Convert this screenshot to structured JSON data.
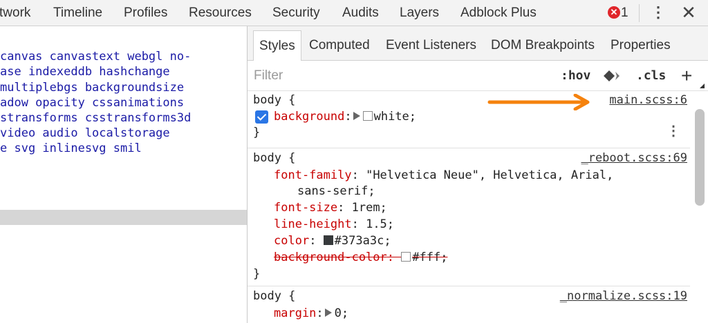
{
  "main_tabs": [
    "twork",
    "Timeline",
    "Profiles",
    "Resources",
    "Security",
    "Audits",
    "Layers",
    "Adblock Plus"
  ],
  "error_count": "1",
  "left_pane": {
    "lines": [
      "canvas canvastext webgl no-",
      "ase indexeddb hashchange",
      "multiplebgs backgroundsize",
      "adow opacity cssanimations",
      "stransforms csstransforms3d",
      "video audio localstorage",
      "e svg inlinesvg smil"
    ]
  },
  "sub_tabs": [
    "Styles",
    "Computed",
    "Event Listeners",
    "DOM Breakpoints",
    "Properties"
  ],
  "filter": {
    "placeholder": "Filter",
    "hov": ":hov",
    "cls": ".cls",
    "add": "+"
  },
  "rules": [
    {
      "selector": "body {",
      "source": "main.scss:6",
      "declarations": [
        {
          "prop": "background",
          "sep": ":",
          "value": "white;",
          "swatch": "#ffffff",
          "expand": true,
          "checked": true
        }
      ],
      "close": "}"
    },
    {
      "selector": "body {",
      "source": "_reboot.scss:69",
      "declarations": [
        {
          "prop": "font-family",
          "sep": ": ",
          "value": "\"Helvetica Neue\", Helvetica, Arial,",
          "continuation": "sans-serif;"
        },
        {
          "prop": "font-size",
          "sep": ": ",
          "value": "1rem;"
        },
        {
          "prop": "line-height",
          "sep": ": ",
          "value": "1.5;"
        },
        {
          "prop": "color",
          "sep": ": ",
          "value": "#373a3c;",
          "swatch": "#373a3c"
        },
        {
          "prop": "background-color",
          "sep": ": ",
          "value": "#fff;",
          "swatch": "#ffffff",
          "overridden": true
        }
      ],
      "close": "}"
    },
    {
      "selector": "body {",
      "source": "_normalize.scss:19",
      "declarations": [
        {
          "prop": "margin",
          "sep": ":",
          "value": "0;",
          "expand": true
        }
      ]
    }
  ],
  "colors": {
    "arrow": "#f5820d",
    "checkbox": "#2b76e5",
    "property": "#c80000",
    "left_code": "#1a1aa6"
  },
  "icons": [
    "error-icon",
    "kebab-menu-icon",
    "close-icon",
    "element-state-paint-icon",
    "add-rule-icon",
    "expand-triangle-icon",
    "rule-menu-icon",
    "annotation-arrow"
  ]
}
